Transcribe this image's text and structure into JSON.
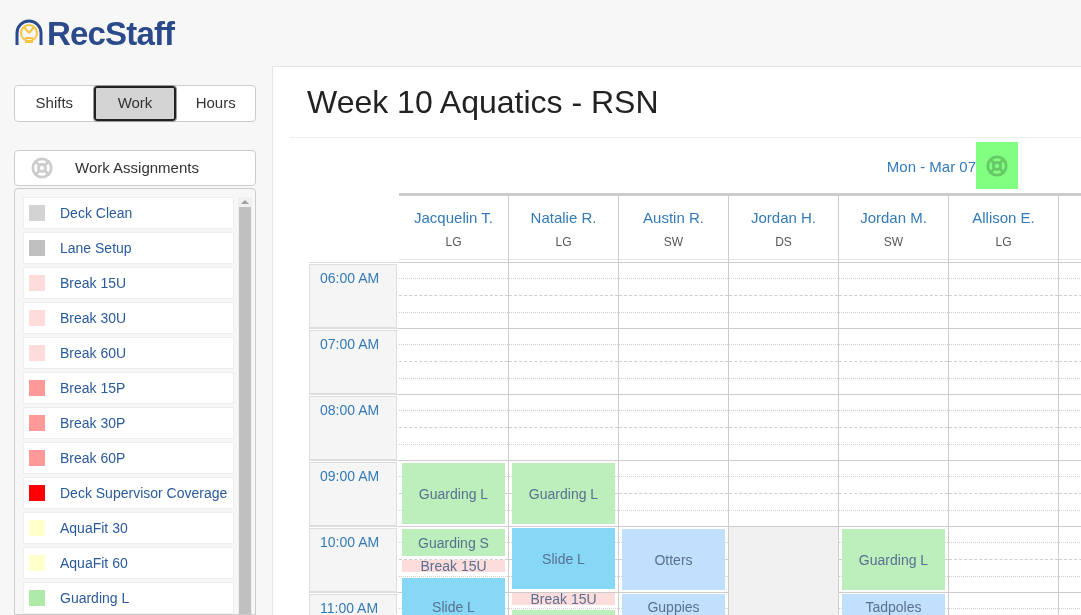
{
  "logo": {
    "text": "RecStaff"
  },
  "view_tabs": [
    {
      "label": "Shifts",
      "selected": false
    },
    {
      "label": "Work",
      "selected": true
    },
    {
      "label": "Hours",
      "selected": false
    }
  ],
  "assignments_panel": {
    "title": "Work Assignments",
    "items": [
      {
        "label": "Deck Clean",
        "color": "#d3d3d3"
      },
      {
        "label": "Lane Setup",
        "color": "#c0c0c0"
      },
      {
        "label": "Break 15U",
        "color": "#ffdcdc"
      },
      {
        "label": "Break 30U",
        "color": "#ffdcdc"
      },
      {
        "label": "Break 60U",
        "color": "#ffdcdc"
      },
      {
        "label": "Break 15P",
        "color": "#ff9999"
      },
      {
        "label": "Break 30P",
        "color": "#ff9999"
      },
      {
        "label": "Break 60P",
        "color": "#ff9999"
      },
      {
        "label": "Deck Supervisor Coverage",
        "color": "#ff0000"
      },
      {
        "label": "AquaFit 30",
        "color": "#ffffcc"
      },
      {
        "label": "AquaFit 60",
        "color": "#ffffcc"
      },
      {
        "label": "Guarding L",
        "color": "#aeeaa8"
      }
    ]
  },
  "page_title": "Week 10 Aquatics - RSN",
  "day": {
    "label": "Mon - Mar 07"
  },
  "times": [
    "06:00 AM",
    "07:00 AM",
    "08:00 AM",
    "09:00 AM",
    "10:00 AM",
    "11:00 AM"
  ],
  "staff": [
    {
      "name": "Jacquelin T.",
      "role": "LG",
      "events": [
        {
          "kind": "assignment",
          "label": "Guarding L",
          "color": "#bdefbc"
        },
        {
          "kind": "assignment",
          "label": "Guarding S",
          "color": "#bdefbc"
        },
        {
          "kind": "assignment",
          "label": "Break 15U",
          "color": "#fddcdc"
        },
        {
          "kind": "assignment",
          "label": "Slide L",
          "color": "#87d7f7"
        }
      ]
    },
    {
      "name": "Natalie R.",
      "role": "LG",
      "events": [
        {
          "kind": "assignment",
          "label": "Guarding L",
          "color": "#bdefbc"
        },
        {
          "kind": "assignment",
          "label": "Slide L",
          "color": "#87d7f7"
        },
        {
          "kind": "assignment",
          "label": "Break 15U",
          "color": "#fddcdc"
        },
        {
          "kind": "assignment",
          "color": "#bdefbc"
        }
      ]
    },
    {
      "name": "Austin R.",
      "role": "SW",
      "events": [
        {
          "kind": "assignment",
          "label": "Otters",
          "color": "#c0e0fd"
        },
        {
          "kind": "assignment",
          "label": "Guppies",
          "color": "#c0e0fd"
        }
      ]
    },
    {
      "name": "Jordan H.",
      "role": "DS",
      "events": [
        {
          "kind": "unavailable"
        }
      ]
    },
    {
      "name": "Jordan M.",
      "role": "SW",
      "events": [
        {
          "kind": "assignment",
          "label": "Guarding L",
          "color": "#bdefbc"
        },
        {
          "kind": "assignment",
          "label": "Tadpoles",
          "color": "#c0e0fd"
        }
      ]
    },
    {
      "name": "Allison E.",
      "role": "LG"
    }
  ]
}
